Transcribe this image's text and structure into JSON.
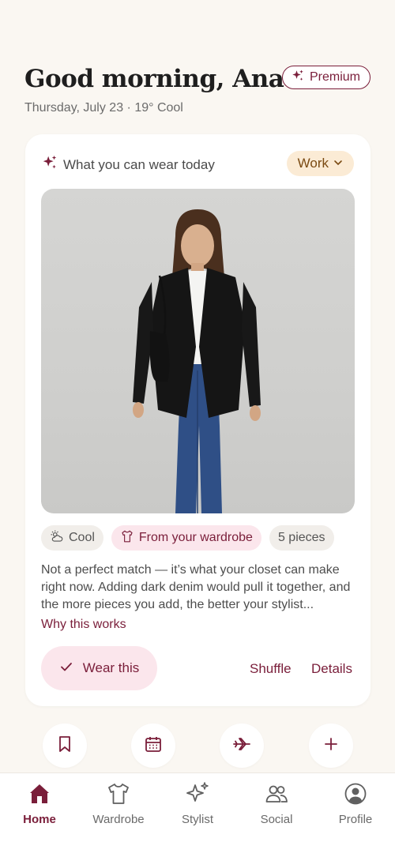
{
  "header": {
    "greeting": "Good morning, Ana",
    "subline": "Thursday, July 23 · 19° Cool",
    "premium_label": "Premium"
  },
  "card": {
    "title": "What you can wear today",
    "occasion": "Work",
    "chips": [
      "Cool",
      "From your wardrobe",
      "5 pieces"
    ],
    "description": "Not a perfect match — it’s what your closet can make right now. Adding dark denim would pull it together, and the more pieces you add, the better your stylist...",
    "why_link": "Why this works",
    "wear_label": "Wear this",
    "shuffle_label": "Shuffle",
    "details_label": "Details"
  },
  "quick_actions": [
    "bookmark-icon",
    "calendar-icon",
    "plane-icon",
    "plus-icon"
  ],
  "tabs": [
    {
      "label": "Home",
      "active": true
    },
    {
      "label": "Wardrobe",
      "active": false
    },
    {
      "label": "Stylist",
      "active": false
    },
    {
      "label": "Social",
      "active": false
    },
    {
      "label": "Profile",
      "active": false
    }
  ],
  "colors": {
    "accent": "#7A1E3A",
    "background": "#FAF7F2",
    "accent_soft": "#FBE6EC",
    "work_pill": "#FBEBD5"
  }
}
